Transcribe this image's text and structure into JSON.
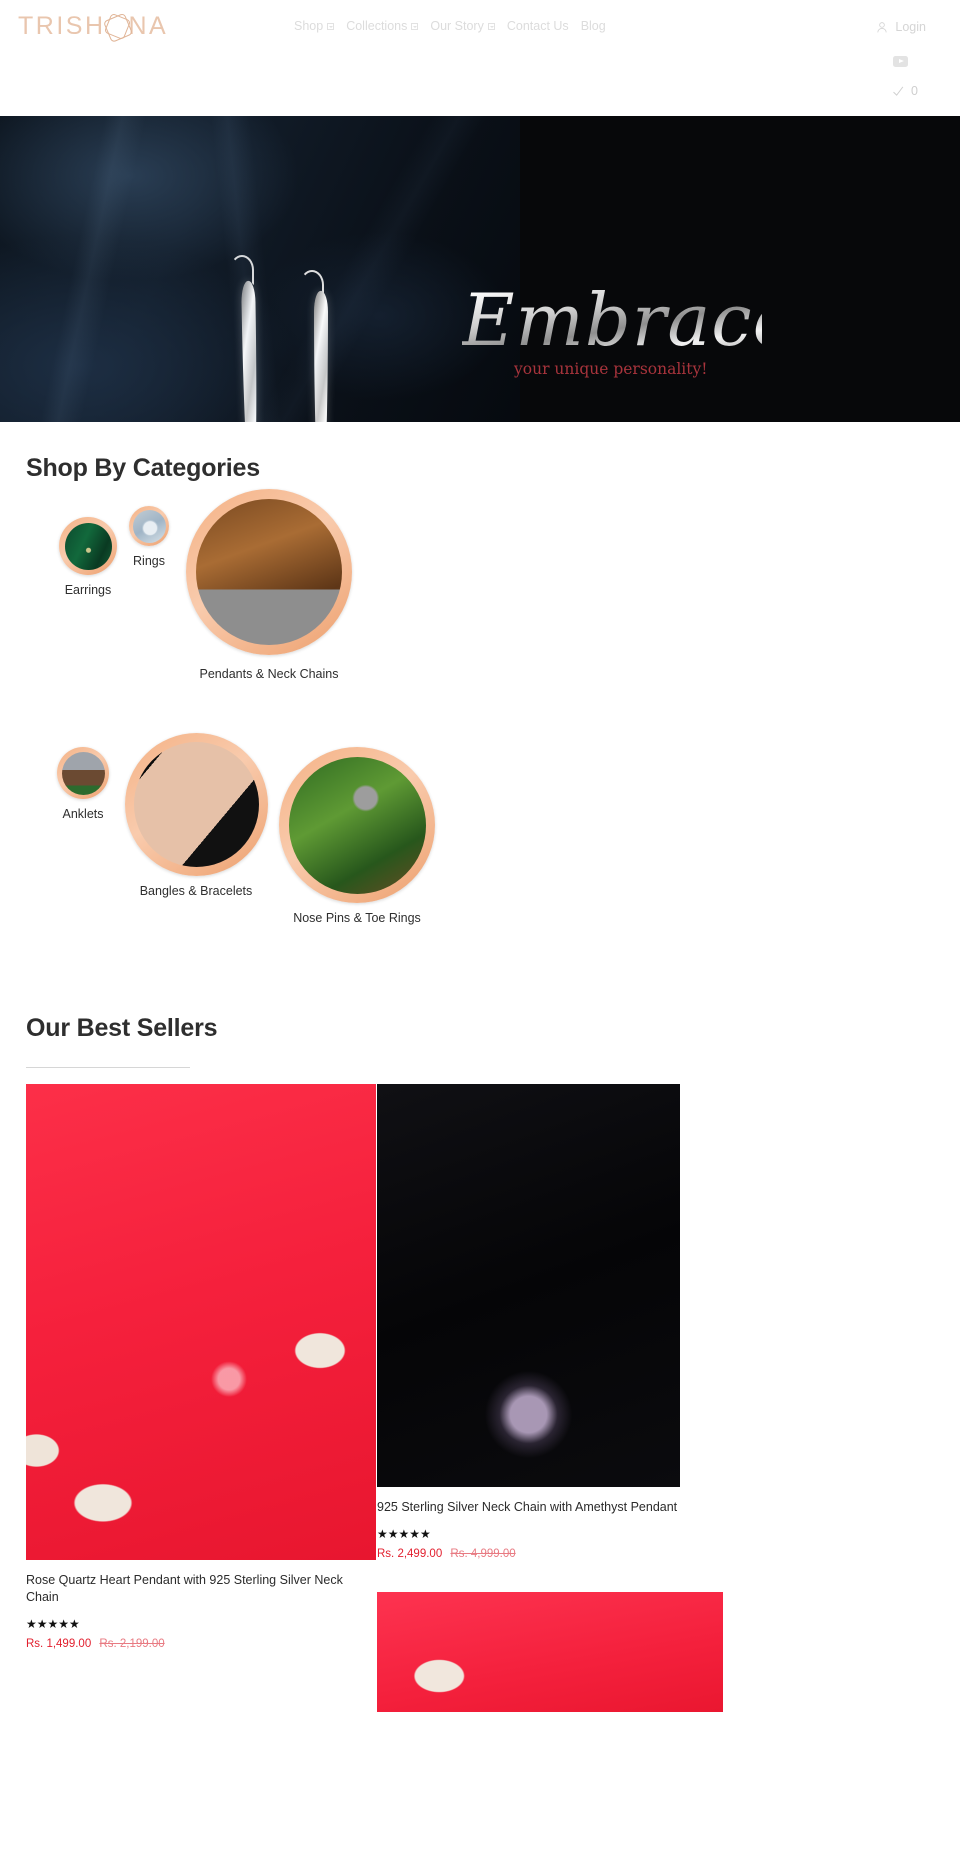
{
  "header": {
    "logo_text_1": "TRISH",
    "logo_text_2": "NA",
    "nav": [
      {
        "label": "Shop",
        "has_dropdown": true
      },
      {
        "label": "Collections",
        "has_dropdown": true
      },
      {
        "label": "Our Story",
        "has_dropdown": true
      },
      {
        "label": "Contact Us",
        "has_dropdown": false
      },
      {
        "label": "Blog",
        "has_dropdown": false
      }
    ],
    "login_label": "Login",
    "cart_count": "0"
  },
  "hero": {
    "headline": "Embrace",
    "subhead": "your unique personality!",
    "subhead_color": "#a8343c"
  },
  "categories_section": {
    "title": "Shop By Categories",
    "items": [
      {
        "label": "Earrings"
      },
      {
        "label": "Rings"
      },
      {
        "label": "Pendants & Neck Chains"
      },
      {
        "label": "Anklets"
      },
      {
        "label": "Bangles & Bracelets"
      },
      {
        "label": "Nose Pins & Toe Rings"
      }
    ],
    "ring_color": "#f4b184"
  },
  "best_sellers": {
    "title": "Our Best Sellers",
    "products": [
      {
        "title": "Rose Quartz Heart Pendant with 925 Sterling Silver Neck Chain",
        "stars": "★★★★★",
        "price": "Rs. 1,499.00",
        "compare_price": "Rs. 2,199.00"
      },
      {
        "title": "925 Sterling Silver Neck Chain with Amethyst Pendant",
        "stars": "★★★★★",
        "price": "Rs. 2,499.00",
        "compare_price": "Rs. 4,999.00"
      },
      {
        "title": "",
        "stars": "",
        "price": "",
        "compare_price": ""
      }
    ],
    "price_color": "#e2202f"
  }
}
